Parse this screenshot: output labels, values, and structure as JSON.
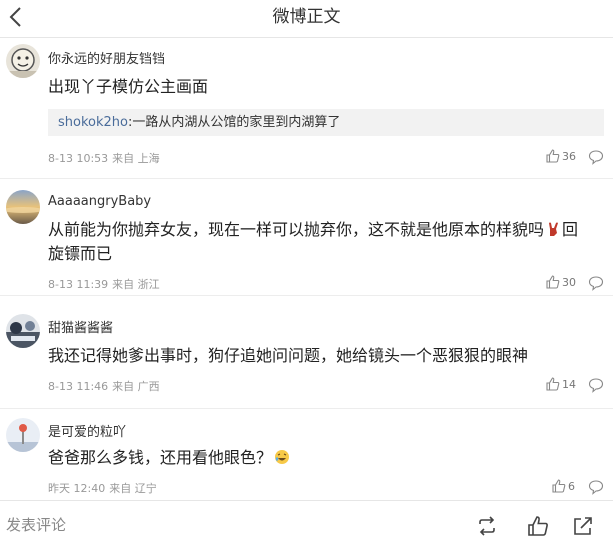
{
  "header": {
    "title": "微博正文"
  },
  "comments": [
    {
      "username": "你永远的好朋友铛铛",
      "text": "出现丫子模仿公主画面",
      "quote": {
        "name": "shokok2ho",
        "text": ":一路从内湖从公馆的家里到内湖算了"
      },
      "time": "8-13 10:53",
      "source": "来自 上海",
      "likes": "36"
    },
    {
      "username": "AaaaangryBaby",
      "text_line1": "从前能为你抛弃女友，现在一样可以抛弃你，这不就是他原本的样貌吗",
      "text_line1_end": "回",
      "text_line2": "旋镖而已",
      "time": "8-13 11:39",
      "source": "来自 浙江",
      "likes": "30"
    },
    {
      "username": "甜猫酱酱酱",
      "text": "我还记得她爹出事时，狗仔追她问问题，她给镜头一个恶狠狠的眼神",
      "time": "8-13 11:46",
      "source": "来自 广西",
      "likes": "14"
    },
    {
      "username": "是可爱的粒吖",
      "text": "爸爸那么多钱，还用看他眼色？",
      "time": "昨天 12:40",
      "source": "来自 辽宁",
      "likes": "6"
    }
  ],
  "footer": {
    "compose_placeholder": "发表评论"
  },
  "colors": {
    "link": "#4a6c9a",
    "meta": "#999999",
    "quote_bg": "#f2f2f2",
    "divider": "#ededed"
  },
  "icons": [
    "back-arrow-icon",
    "thumbs-up-icon",
    "reply-bubble-icon",
    "repost-icon",
    "share-icon",
    "rock-hand-emoji",
    "laughing-emoji"
  ]
}
